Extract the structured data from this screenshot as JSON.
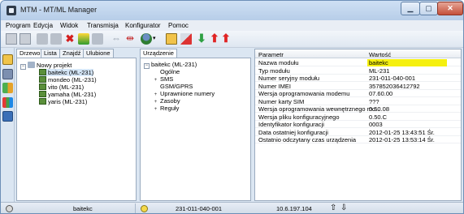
{
  "window": {
    "title": "MTM - MT/ML Manager",
    "min_glyph": "▁",
    "max_glyph": "▢",
    "close_glyph": "✕"
  },
  "menu": [
    "Program",
    "Edycja",
    "Widok",
    "Transmisja",
    "Konfigurator",
    "Pomoc"
  ],
  "toolbar_icons": [
    "new-icon",
    "open-icon",
    "connect-icon",
    "tools-icon",
    "delete-icon",
    "chart-icon",
    "save-icon",
    "link-icon",
    "link-red-icon",
    "user-icon",
    "dropdown-arrow-icon",
    "card-icon",
    "upload-red-icon",
    "download-green-icon",
    "arrow-up-red-icon",
    "arrow-up-red2-icon"
  ],
  "left_tabs": [
    "Drzewo",
    "Lista",
    "Znajdź",
    "Ulubione"
  ],
  "left_tree": {
    "root": "Nowy projekt",
    "items": [
      "baitekc (ML-231)",
      "mondeo (ML-231)",
      "vito (ML-231)",
      "yamaha (ML-231)",
      "yaris (ML-231)"
    ]
  },
  "mid_tab": "Urządzenie",
  "device_tree": {
    "root": "baitekc (ML-231)",
    "items": [
      {
        "label": "Ogólne",
        "expandable": false
      },
      {
        "label": "SMS",
        "expandable": true
      },
      {
        "label": "GSM/GPRS",
        "expandable": false
      },
      {
        "label": "Uprawnione numery",
        "expandable": true
      },
      {
        "label": "Zasoby",
        "expandable": true
      },
      {
        "label": "Reguły",
        "expandable": true
      }
    ]
  },
  "grid": {
    "col_param": "Parametr",
    "col_value": "Wartość",
    "rows": [
      {
        "param": "Nazwa modułu",
        "value": "baitekc"
      },
      {
        "param": "Typ modułu",
        "value": "ML-231"
      },
      {
        "param": "Numer seryjny modułu",
        "value": "231-011-040-001"
      },
      {
        "param": "Numer IMEI",
        "value": "357852036412792"
      },
      {
        "param": "Wersja oprogramowania modemu",
        "value": "07.60.00"
      },
      {
        "param": "Numer karty SIM",
        "value": "???"
      },
      {
        "param": "Wersja oprogramowania wewnętrznego mo...",
        "value": "0.50.08"
      },
      {
        "param": "Wersja pliku konfiguracyjnego",
        "value": "0.50.C"
      },
      {
        "param": "Identyfikator konfiguracji",
        "value": "0003"
      },
      {
        "param": "Data ostatniej konfiguracji",
        "value": "2012-01-25 13:43:51 Śr."
      },
      {
        "param": "Ostatnio odczytany czas urządzenia",
        "value": "2012-01-25 13:53:14 Śr."
      }
    ]
  },
  "status": {
    "device": "baitekc",
    "serial": "231-011-040-001",
    "ip": "10.6.197.104",
    "accent_connected": "#f5f00f"
  }
}
